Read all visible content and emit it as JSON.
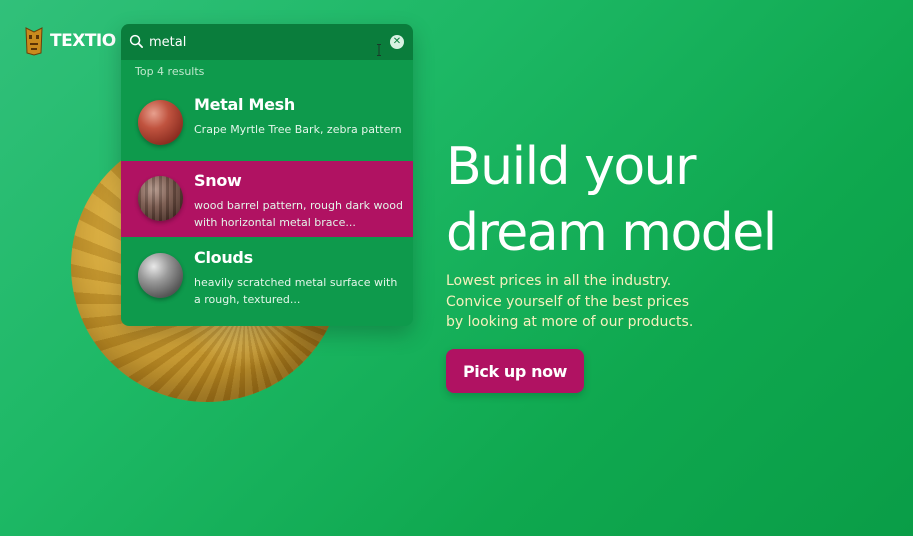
{
  "brand": {
    "name": "TEXTIO",
    "logo_icon": "tiki-mask-icon"
  },
  "search": {
    "query": "metal",
    "search_icon": "search-icon",
    "clear_icon": "close-icon",
    "results_header": "Top 4 results",
    "results": [
      {
        "title": "Metal Mesh",
        "description": "Crape Myrtle Tree Bark, zebra pattern",
        "selected": false
      },
      {
        "title": "Snow",
        "description": "wood barrel pattern, rough dark wood with horizontal metal brace...",
        "selected": true
      },
      {
        "title": "Clouds",
        "description": "heavily scratched metal surface with a rough, textured...",
        "selected": false
      }
    ]
  },
  "hero": {
    "title_line1": "Build your",
    "title_line2": "dream model",
    "subtitle_lines": [
      "Lowest prices in all the industry.",
      "Convice yourself of the best prices",
      "by looking at more of our products."
    ],
    "cta_label": "Pick up now"
  },
  "colors": {
    "background": "#1db865",
    "panel": "#0e9a4c",
    "accent": "#b01262",
    "subtitle": "#f6f0bd"
  }
}
